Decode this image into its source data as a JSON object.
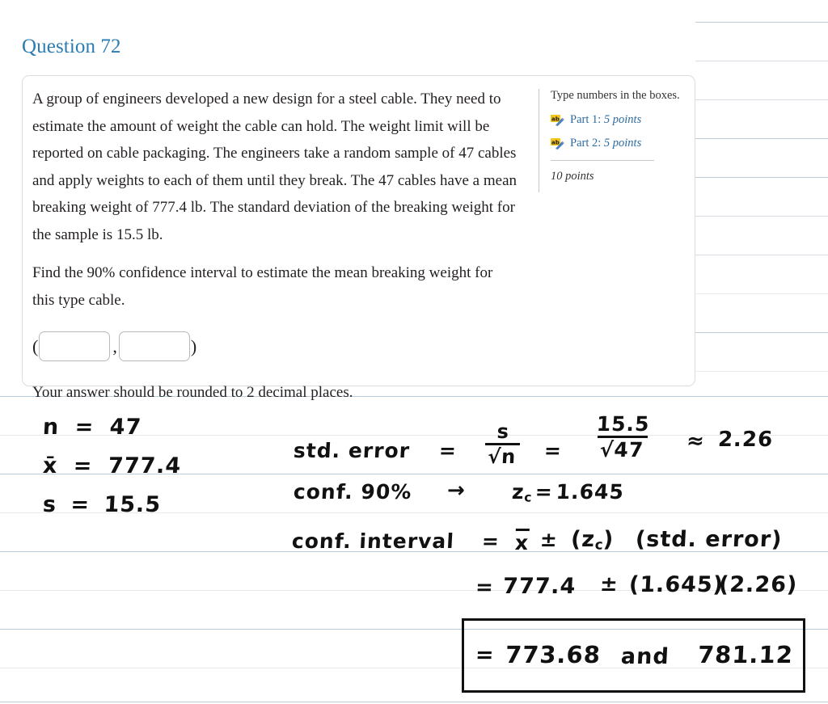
{
  "page": {
    "title": "Question 72",
    "accent_color": "#2b7cb3",
    "link_color": "#2b6ca3",
    "rule_color": "#d9dde3",
    "rule_blue_color": "#b9ccd9"
  },
  "question": {
    "paragraph1": "A group of engineers developed a new design for a steel cable. They need to estimate the amount of weight the cable can hold. The weight limit will be reported on cable packaging. The engineers take a random sample of 47 cables and apply weights to each of them until they break. The 47 cables have a mean breaking weight of 777.4 lb. The standard deviation of the breaking weight for the sample is 15.5 lb.",
    "paragraph2": "Find the 90% confidence interval to estimate the mean breaking weight for this type cable.",
    "paragraph3": "Your answer should be rounded to 2 decimal places.",
    "answer": {
      "open_paren": "(",
      "close_paren": ")",
      "separator": ",",
      "lower_value": "",
      "upper_value": "",
      "lower_placeholder": "",
      "upper_placeholder": ""
    }
  },
  "info_panel": {
    "instruction": "Type numbers in the boxes.",
    "parts": [
      {
        "icon": "ab-pencil-icon",
        "name": "Part 1",
        "separator": ": ",
        "points": "5 points"
      },
      {
        "icon": "ab-pencil-icon",
        "name": "Part 2",
        "separator": ": ",
        "points": "5 points"
      }
    ],
    "total_points": "10 points"
  },
  "handwritten_work": {
    "given": [
      {
        "label": "n",
        "eq": "=",
        "value": "47"
      },
      {
        "label": "x̄",
        "eq": "=",
        "value": "777.4"
      },
      {
        "label": "s",
        "eq": "=",
        "value": "15.5"
      }
    ],
    "std_error": {
      "label": "std. error",
      "eq1": "=",
      "formula_num": "s",
      "formula_den": "√n",
      "eq2": "=",
      "value_num": "15.5",
      "value_den": "√47",
      "approx": "≈",
      "result": "2.26"
    },
    "confidence": {
      "label": "conf. 90%",
      "arrow": "→",
      "z_label": "z",
      "z_sub": "c",
      "z_eq": "=",
      "z_value": "1.645"
    },
    "interval_formula": {
      "label": "conf. interval",
      "eq": "=",
      "xbar": "x",
      "plusminus": "±",
      "term1": "(z",
      "term1_sub": "c",
      "term1_close": ")",
      "term2": "(std. error)"
    },
    "substitution": {
      "eq": "=",
      "mean": "777.4",
      "plusminus": "±",
      "z": "(1.645)",
      "se": "(2.26)"
    },
    "final_answer": {
      "eq": "=",
      "lower": "773.68",
      "conjunction": "and",
      "upper": "781.12"
    }
  }
}
